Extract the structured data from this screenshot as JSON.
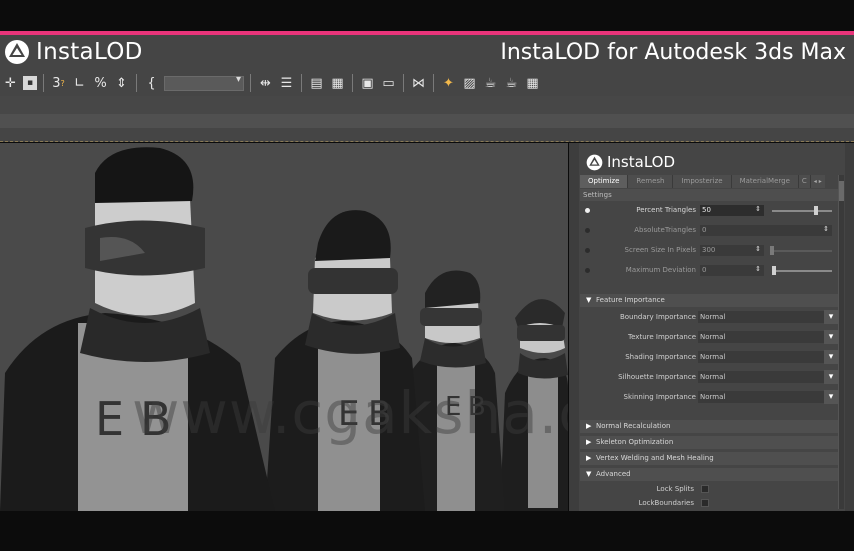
{
  "header": {
    "logo_text": "InstaLOD",
    "title": "InstaLOD for Autodesk 3ds Max"
  },
  "toolbar": {
    "icons": [
      "move-icon",
      "select-icon",
      "snap-3d-icon",
      "angle-snap-icon",
      "percent-snap-icon",
      "spinner-snap-icon",
      "named-selection-icon",
      "mirror-icon",
      "align-icon",
      "layer-manager-icon",
      "scene-explorer-icon",
      "render-setup-icon",
      "material-editor-icon",
      "schematic-view-icon",
      "render-frame-icon",
      "render-icon",
      "render-production-icon",
      "render-active-icon",
      "grid-icon"
    ],
    "glyphs": {
      "snap": "3",
      "snap_sup": "?",
      "percent": "%",
      "braces": "{"
    },
    "named_selection_value": ""
  },
  "viewport": {
    "watermark": "www.cgaksha.com",
    "shirt_letters": [
      "E",
      "B"
    ]
  },
  "panel": {
    "logo_text": "InstaLOD",
    "tabs": [
      {
        "label": "Optimize",
        "active": true
      },
      {
        "label": "Remesh",
        "active": false
      },
      {
        "label": "Imposterize",
        "active": false
      },
      {
        "label": "MaterialMerge",
        "active": false
      },
      {
        "label": "C",
        "active": false
      }
    ],
    "tab_arrows": "◂ ▸",
    "settings_label": "Settings",
    "settings": [
      {
        "label": "Percent Triangles",
        "value": "50",
        "selected": true,
        "slider_fraction": 0.75
      },
      {
        "label": "AbsoluteTriangles",
        "value": "0",
        "selected": false,
        "slider_fraction": null
      },
      {
        "label": "Screen Size In Pixels",
        "value": "300",
        "selected": false,
        "slider_fraction": 0.75
      },
      {
        "label": "Maximum Deviation",
        "value": "0",
        "selected": false,
        "slider_fraction": 0.0
      }
    ],
    "feature_importance": {
      "label": "Feature Importance",
      "expanded": true,
      "items": [
        {
          "label": "Boundary Importance",
          "value": "Normal"
        },
        {
          "label": "Texture Importance",
          "value": "Normal"
        },
        {
          "label": "Shading Importance",
          "value": "Normal"
        },
        {
          "label": "Silhouette Importance",
          "value": "Normal"
        },
        {
          "label": "Skinning Importance",
          "value": "Normal"
        }
      ]
    },
    "collapsed_sections": [
      "Normal Recalculation",
      "Skeleton Optimization",
      "Vertex Welding and Mesh Healing"
    ],
    "advanced": {
      "label": "Advanced",
      "items": [
        {
          "label": "Lock Splits",
          "checked": false
        },
        {
          "label": "LockBoundaries",
          "checked": false
        }
      ]
    }
  },
  "colors": {
    "accent_pink": "#e8347a",
    "header_bg": "#454545",
    "viewport_bg": "#4a4a4a"
  }
}
